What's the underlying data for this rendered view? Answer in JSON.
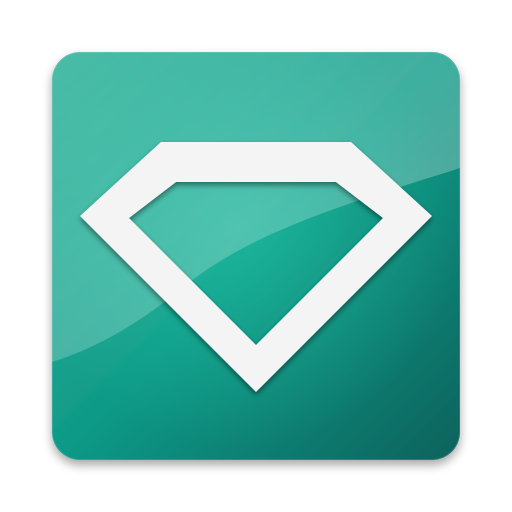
{
  "app_icon": {
    "icon": "diamond-icon",
    "colors": {
      "tile_light": "#3fb9a2",
      "tile_mid": "#0e9a87",
      "tile_dark": "#07625c",
      "gloss": "#ffffff",
      "glyph": "#f4f4f4",
      "glyph_inner": "#0b9583",
      "shadow": "#000000"
    }
  }
}
